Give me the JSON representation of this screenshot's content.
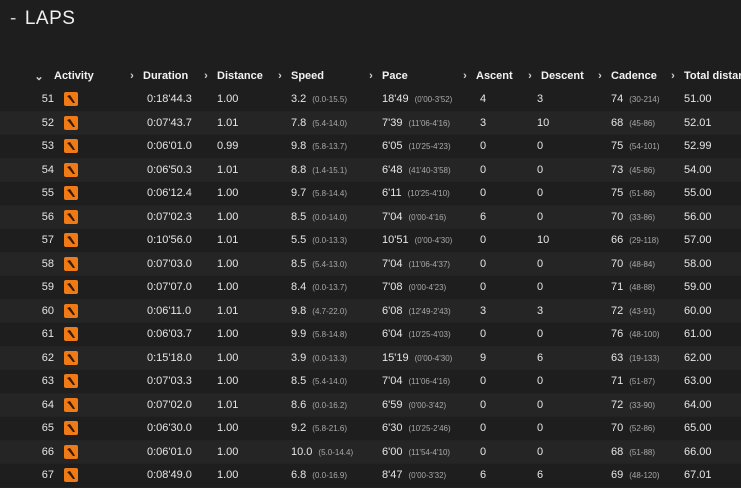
{
  "section": {
    "title": "LAPS",
    "collapse_glyph": "-"
  },
  "colors": {
    "accent": "#f07b16",
    "background": "#1e1e1e"
  },
  "columns": [
    {
      "key": "activity",
      "label": "Activity"
    },
    {
      "key": "duration",
      "label": "Duration"
    },
    {
      "key": "distance",
      "label": "Distance"
    },
    {
      "key": "speed",
      "label": "Speed"
    },
    {
      "key": "pace",
      "label": "Pace"
    },
    {
      "key": "ascent",
      "label": "Ascent"
    },
    {
      "key": "descent",
      "label": "Descent"
    },
    {
      "key": "cadence",
      "label": "Cadence"
    },
    {
      "key": "total",
      "label": "Total distance"
    }
  ],
  "rows": [
    {
      "lap": "51",
      "duration": "0:18'44.3",
      "distance": "1.00",
      "speed": "3.2",
      "speed_range": "(0.0-15.5)",
      "pace": "18'49",
      "pace_range": "(0'00-3'52)",
      "ascent": "4",
      "descent": "3",
      "cadence": "74",
      "cadence_range": "(30-214)",
      "total": "51.00"
    },
    {
      "lap": "52",
      "duration": "0:07'43.7",
      "distance": "1.01",
      "speed": "7.8",
      "speed_range": "(5.4-14.0)",
      "pace": "7'39",
      "pace_range": "(11'06-4'16)",
      "ascent": "3",
      "descent": "10",
      "cadence": "68",
      "cadence_range": "(45-86)",
      "total": "52.01"
    },
    {
      "lap": "53",
      "duration": "0:06'01.0",
      "distance": "0.99",
      "speed": "9.8",
      "speed_range": "(5.8-13.7)",
      "pace": "6'05",
      "pace_range": "(10'25-4'23)",
      "ascent": "0",
      "descent": "0",
      "cadence": "75",
      "cadence_range": "(54-101)",
      "total": "52.99"
    },
    {
      "lap": "54",
      "duration": "0:06'50.3",
      "distance": "1.01",
      "speed": "8.8",
      "speed_range": "(1.4-15.1)",
      "pace": "6'48",
      "pace_range": "(41'40-3'58)",
      "ascent": "0",
      "descent": "0",
      "cadence": "73",
      "cadence_range": "(45-86)",
      "total": "54.00"
    },
    {
      "lap": "55",
      "duration": "0:06'12.4",
      "distance": "1.00",
      "speed": "9.7",
      "speed_range": "(5.8-14.4)",
      "pace": "6'11",
      "pace_range": "(10'25-4'10)",
      "ascent": "0",
      "descent": "0",
      "cadence": "75",
      "cadence_range": "(51-86)",
      "total": "55.00"
    },
    {
      "lap": "56",
      "duration": "0:07'02.3",
      "distance": "1.00",
      "speed": "8.5",
      "speed_range": "(0.0-14.0)",
      "pace": "7'04",
      "pace_range": "(0'00-4'16)",
      "ascent": "6",
      "descent": "0",
      "cadence": "70",
      "cadence_range": "(33-86)",
      "total": "56.00"
    },
    {
      "lap": "57",
      "duration": "0:10'56.0",
      "distance": "1.01",
      "speed": "5.5",
      "speed_range": "(0.0-13.3)",
      "pace": "10'51",
      "pace_range": "(0'00-4'30)",
      "ascent": "0",
      "descent": "10",
      "cadence": "66",
      "cadence_range": "(29-118)",
      "total": "57.00"
    },
    {
      "lap": "58",
      "duration": "0:07'03.0",
      "distance": "1.00",
      "speed": "8.5",
      "speed_range": "(5.4-13.0)",
      "pace": "7'04",
      "pace_range": "(11'06-4'37)",
      "ascent": "0",
      "descent": "0",
      "cadence": "70",
      "cadence_range": "(48-84)",
      "total": "58.00"
    },
    {
      "lap": "59",
      "duration": "0:07'07.0",
      "distance": "1.00",
      "speed": "8.4",
      "speed_range": "(0.0-13.7)",
      "pace": "7'08",
      "pace_range": "(0'00-4'23)",
      "ascent": "0",
      "descent": "0",
      "cadence": "71",
      "cadence_range": "(48-88)",
      "total": "59.00"
    },
    {
      "lap": "60",
      "duration": "0:06'11.0",
      "distance": "1.01",
      "speed": "9.8",
      "speed_range": "(4.7-22.0)",
      "pace": "6'08",
      "pace_range": "(12'49-2'43)",
      "ascent": "3",
      "descent": "3",
      "cadence": "72",
      "cadence_range": "(43-91)",
      "total": "60.00"
    },
    {
      "lap": "61",
      "duration": "0:06'03.7",
      "distance": "1.00",
      "speed": "9.9",
      "speed_range": "(5.8-14.8)",
      "pace": "6'04",
      "pace_range": "(10'25-4'03)",
      "ascent": "0",
      "descent": "0",
      "cadence": "76",
      "cadence_range": "(48-100)",
      "total": "61.00"
    },
    {
      "lap": "62",
      "duration": "0:15'18.0",
      "distance": "1.00",
      "speed": "3.9",
      "speed_range": "(0.0-13.3)",
      "pace": "15'19",
      "pace_range": "(0'00-4'30)",
      "ascent": "9",
      "descent": "6",
      "cadence": "63",
      "cadence_range": "(19-133)",
      "total": "62.00"
    },
    {
      "lap": "63",
      "duration": "0:07'03.3",
      "distance": "1.00",
      "speed": "8.5",
      "speed_range": "(5.4-14.0)",
      "pace": "7'04",
      "pace_range": "(11'06-4'16)",
      "ascent": "0",
      "descent": "0",
      "cadence": "71",
      "cadence_range": "(51-87)",
      "total": "63.00"
    },
    {
      "lap": "64",
      "duration": "0:07'02.0",
      "distance": "1.01",
      "speed": "8.6",
      "speed_range": "(0.0-16.2)",
      "pace": "6'59",
      "pace_range": "(0'00-3'42)",
      "ascent": "0",
      "descent": "0",
      "cadence": "72",
      "cadence_range": "(33-90)",
      "total": "64.00"
    },
    {
      "lap": "65",
      "duration": "0:06'30.0",
      "distance": "1.00",
      "speed": "9.2",
      "speed_range": "(5.8-21.6)",
      "pace": "6'30",
      "pace_range": "(10'25-2'46)",
      "ascent": "0",
      "descent": "0",
      "cadence": "70",
      "cadence_range": "(52-86)",
      "total": "65.00"
    },
    {
      "lap": "66",
      "duration": "0:06'01.0",
      "distance": "1.00",
      "speed": "10.0",
      "speed_range": "(5.0-14.4)",
      "pace": "6'00",
      "pace_range": "(11'54-4'10)",
      "ascent": "0",
      "descent": "0",
      "cadence": "68",
      "cadence_range": "(51-88)",
      "total": "66.00"
    },
    {
      "lap": "67",
      "duration": "0:08'49.0",
      "distance": "1.00",
      "speed": "6.8",
      "speed_range": "(0.0-16.9)",
      "pace": "8'47",
      "pace_range": "(0'00-3'32)",
      "ascent": "6",
      "descent": "6",
      "cadence": "69",
      "cadence_range": "(48-120)",
      "total": "67.01"
    }
  ]
}
